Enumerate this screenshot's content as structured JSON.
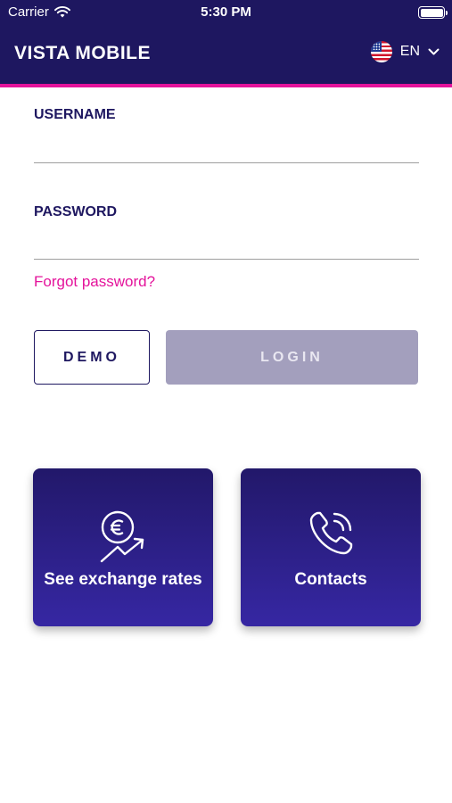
{
  "status_bar": {
    "carrier": "Carrier",
    "time": "5:30 PM"
  },
  "app_bar": {
    "title": "VISTA MOBILE",
    "language": "EN",
    "flag_icon": "us-flag-icon"
  },
  "form": {
    "username_label": "USERNAME",
    "username_value": "",
    "password_label": "PASSWORD",
    "password_value": "",
    "forgot_password": "Forgot password?"
  },
  "buttons": {
    "demo": "DEMO",
    "login": "LOGIN"
  },
  "cards": {
    "exchange": {
      "label": "See exchange rates",
      "icon": "euro-trend-icon"
    },
    "contacts": {
      "label": "Contacts",
      "icon": "phone-call-icon"
    }
  },
  "colors": {
    "brand": "#1e1760",
    "accent": "#e4139b",
    "login_disabled": "#a39fbd",
    "card_gradient_end": "#3627a3"
  }
}
